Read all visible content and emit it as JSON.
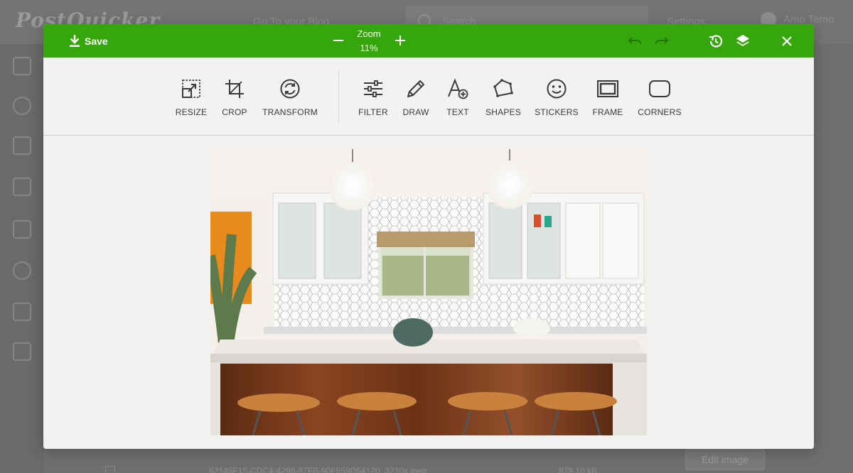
{
  "background_app": {
    "logo": "PostQuicker",
    "blog_link": "Go To your Blog",
    "search_placeholder": "Search",
    "settings_label": "Settings",
    "user_name": "Amo Temo",
    "file_name": "62145F15-CDC4-4296-87FB-90F559D54120_3210x.jpeg",
    "file_size": "879.10 kB",
    "edit_image_label": "Edit image"
  },
  "editor": {
    "save_label": "Save",
    "zoom_label": "Zoom",
    "zoom_value": "11%",
    "tools": [
      {
        "label": "RESIZE",
        "icon": "resize-icon"
      },
      {
        "label": "CROP",
        "icon": "crop-icon"
      },
      {
        "label": "TRANSFORM",
        "icon": "transform-icon"
      },
      {
        "label": "FILTER",
        "icon": "filter-icon"
      },
      {
        "label": "DRAW",
        "icon": "pencil-icon"
      },
      {
        "label": "TEXT",
        "icon": "text-icon"
      },
      {
        "label": "SHAPES",
        "icon": "shapes-icon"
      },
      {
        "label": "STICKERS",
        "icon": "smiley-icon"
      },
      {
        "label": "FRAME",
        "icon": "frame-icon"
      },
      {
        "label": "CORNERS",
        "icon": "corners-icon"
      }
    ],
    "colors": {
      "topbar": "#36a70a",
      "toolbar_bg": "#f2f2f2",
      "icon": "#3a3a3a",
      "disabled_icon": "#1f7a05"
    }
  }
}
